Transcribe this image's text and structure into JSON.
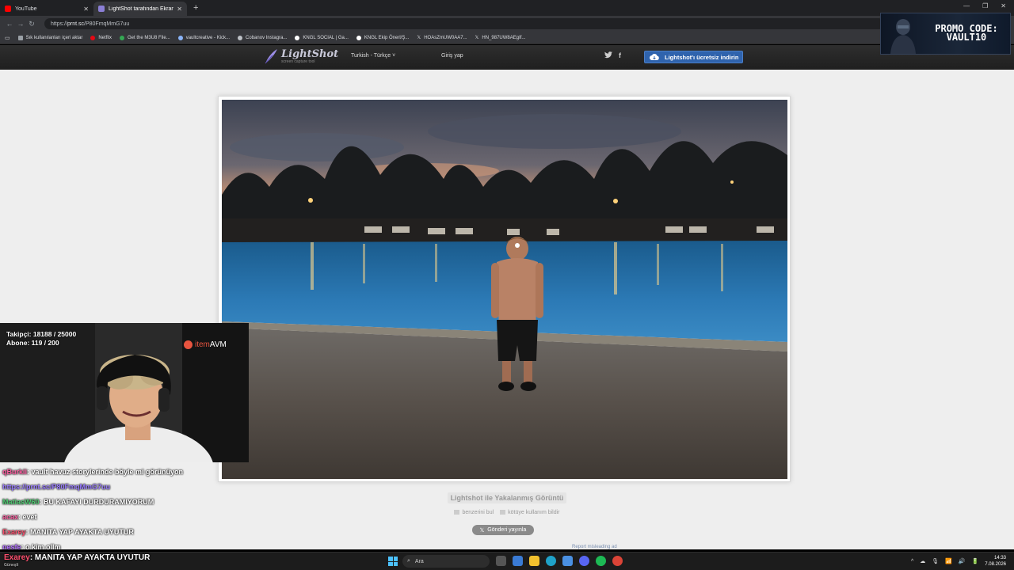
{
  "browser": {
    "tabs": [
      {
        "title": "YouTube",
        "color": "#ff0000"
      },
      {
        "title": "LightShot tarafından Ekran Görün",
        "color": "#8b7fd6"
      }
    ],
    "new_tab": "+",
    "url_prefix": "https://",
    "url_host": "prnt.sc",
    "url_path": "/P80FmqMmG7uu",
    "bookmarks": [
      {
        "label": "Sık kullanılanları içeri aktar",
        "color": "#9aa0a6"
      },
      {
        "label": "Netflix",
        "color": "#e50914"
      },
      {
        "label": "Get the M3U8 File...",
        "color": "#34a853"
      },
      {
        "label": "vaultcreative - Kick...",
        "color": "#8ab4f8"
      },
      {
        "label": "Cobanov Instagra...",
        "color": "#bdc1c6"
      },
      {
        "label": "KNGL SOCIAL | Ga...",
        "color": "#ffffff"
      },
      {
        "label": "KNGL Ekip Önerl/Ş...",
        "color": "#ffffff"
      },
      {
        "label": "HOAsZmUW0AA7...",
        "color": "#ffffff"
      },
      {
        "label": "HN_987UW8AEgIf...",
        "color": "#ffffff"
      }
    ]
  },
  "lightshot": {
    "logo_name": "LightShot",
    "logo_tag": "screen capture tool",
    "language": "Turkish - Türkçe ˅",
    "login": "Giriş yap",
    "twitter": "🐦",
    "facebook": "f",
    "download_label": "Lightshot'ı ücretsiz indirin",
    "caption": "Lightshot ile Yakalanmış Görüntü",
    "find_similar": "benzerini bul",
    "report_abuse": "kötüye kullanım bildir",
    "post_button": "Gönderi yayınla",
    "report_ad": "Report misleading ad"
  },
  "stream": {
    "followers": "Takipçi: 18188 / 25000",
    "subs": "Abone: 119 / 200",
    "sponsor_prefix": "item",
    "sponsor_suffix": "AVM",
    "promo_line1": "PROMO CODE:",
    "promo_line2": "VAULT10",
    "chat": [
      {
        "user": "qBurkii",
        "text": ": vault havuz storylerinde böyle mi görünüyon",
        "color": "#ff5fa2"
      },
      {
        "user": "https://prnt.sc/P80FmqMmG7uu",
        "text": "",
        "color": "#9a7cff"
      },
      {
        "user": "MatiasW60",
        "text": ": BU KAFAYI DURDURAMIYORUM",
        "color": "#4ecb71"
      },
      {
        "user": "acax",
        "text": ": evet",
        "color": "#ff5fa2"
      },
      {
        "user": "Exarey",
        "text": ": MANITA YAP AYAKTA UYUTUR",
        "color": "#ff4f6e"
      },
      {
        "user": "nesfe",
        "text": ": o kim ollm",
        "color": "#b06cff"
      },
      {
        "user": "Exarey",
        "text": ": MANITA YAP AYAKTA UYUTUR",
        "color": "#ff4f6e"
      }
    ],
    "bottom_sub": "Güneşli"
  },
  "taskbar": {
    "search_placeholder": "Ara",
    "time": "14:33",
    "date": "7.08.2026",
    "tray_icons": [
      "^",
      "☁",
      "🎙",
      "📶",
      "🔊",
      "🔋"
    ]
  }
}
